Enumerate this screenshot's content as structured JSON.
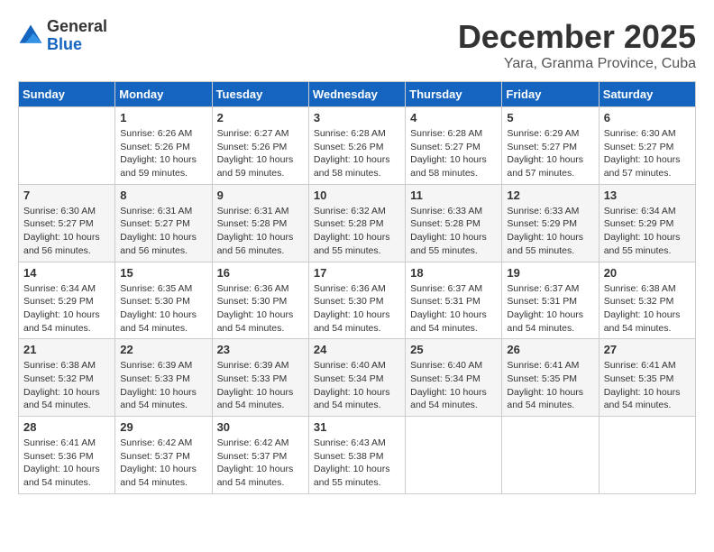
{
  "header": {
    "logo_line1": "General",
    "logo_line2": "Blue",
    "month": "December 2025",
    "location": "Yara, Granma Province, Cuba"
  },
  "days": [
    "Sunday",
    "Monday",
    "Tuesday",
    "Wednesday",
    "Thursday",
    "Friday",
    "Saturday"
  ],
  "weeks": [
    [
      {
        "date": "",
        "info": ""
      },
      {
        "date": "1",
        "info": "Sunrise: 6:26 AM\nSunset: 5:26 PM\nDaylight: 10 hours\nand 59 minutes."
      },
      {
        "date": "2",
        "info": "Sunrise: 6:27 AM\nSunset: 5:26 PM\nDaylight: 10 hours\nand 59 minutes."
      },
      {
        "date": "3",
        "info": "Sunrise: 6:28 AM\nSunset: 5:26 PM\nDaylight: 10 hours\nand 58 minutes."
      },
      {
        "date": "4",
        "info": "Sunrise: 6:28 AM\nSunset: 5:27 PM\nDaylight: 10 hours\nand 58 minutes."
      },
      {
        "date": "5",
        "info": "Sunrise: 6:29 AM\nSunset: 5:27 PM\nDaylight: 10 hours\nand 57 minutes."
      },
      {
        "date": "6",
        "info": "Sunrise: 6:30 AM\nSunset: 5:27 PM\nDaylight: 10 hours\nand 57 minutes."
      }
    ],
    [
      {
        "date": "7",
        "info": "Sunrise: 6:30 AM\nSunset: 5:27 PM\nDaylight: 10 hours\nand 56 minutes."
      },
      {
        "date": "8",
        "info": "Sunrise: 6:31 AM\nSunset: 5:27 PM\nDaylight: 10 hours\nand 56 minutes."
      },
      {
        "date": "9",
        "info": "Sunrise: 6:31 AM\nSunset: 5:28 PM\nDaylight: 10 hours\nand 56 minutes."
      },
      {
        "date": "10",
        "info": "Sunrise: 6:32 AM\nSunset: 5:28 PM\nDaylight: 10 hours\nand 55 minutes."
      },
      {
        "date": "11",
        "info": "Sunrise: 6:33 AM\nSunset: 5:28 PM\nDaylight: 10 hours\nand 55 minutes."
      },
      {
        "date": "12",
        "info": "Sunrise: 6:33 AM\nSunset: 5:29 PM\nDaylight: 10 hours\nand 55 minutes."
      },
      {
        "date": "13",
        "info": "Sunrise: 6:34 AM\nSunset: 5:29 PM\nDaylight: 10 hours\nand 55 minutes."
      }
    ],
    [
      {
        "date": "14",
        "info": "Sunrise: 6:34 AM\nSunset: 5:29 PM\nDaylight: 10 hours\nand 54 minutes."
      },
      {
        "date": "15",
        "info": "Sunrise: 6:35 AM\nSunset: 5:30 PM\nDaylight: 10 hours\nand 54 minutes."
      },
      {
        "date": "16",
        "info": "Sunrise: 6:36 AM\nSunset: 5:30 PM\nDaylight: 10 hours\nand 54 minutes."
      },
      {
        "date": "17",
        "info": "Sunrise: 6:36 AM\nSunset: 5:30 PM\nDaylight: 10 hours\nand 54 minutes."
      },
      {
        "date": "18",
        "info": "Sunrise: 6:37 AM\nSunset: 5:31 PM\nDaylight: 10 hours\nand 54 minutes."
      },
      {
        "date": "19",
        "info": "Sunrise: 6:37 AM\nSunset: 5:31 PM\nDaylight: 10 hours\nand 54 minutes."
      },
      {
        "date": "20",
        "info": "Sunrise: 6:38 AM\nSunset: 5:32 PM\nDaylight: 10 hours\nand 54 minutes."
      }
    ],
    [
      {
        "date": "21",
        "info": "Sunrise: 6:38 AM\nSunset: 5:32 PM\nDaylight: 10 hours\nand 54 minutes."
      },
      {
        "date": "22",
        "info": "Sunrise: 6:39 AM\nSunset: 5:33 PM\nDaylight: 10 hours\nand 54 minutes."
      },
      {
        "date": "23",
        "info": "Sunrise: 6:39 AM\nSunset: 5:33 PM\nDaylight: 10 hours\nand 54 minutes."
      },
      {
        "date": "24",
        "info": "Sunrise: 6:40 AM\nSunset: 5:34 PM\nDaylight: 10 hours\nand 54 minutes."
      },
      {
        "date": "25",
        "info": "Sunrise: 6:40 AM\nSunset: 5:34 PM\nDaylight: 10 hours\nand 54 minutes."
      },
      {
        "date": "26",
        "info": "Sunrise: 6:41 AM\nSunset: 5:35 PM\nDaylight: 10 hours\nand 54 minutes."
      },
      {
        "date": "27",
        "info": "Sunrise: 6:41 AM\nSunset: 5:35 PM\nDaylight: 10 hours\nand 54 minutes."
      }
    ],
    [
      {
        "date": "28",
        "info": "Sunrise: 6:41 AM\nSunset: 5:36 PM\nDaylight: 10 hours\nand 54 minutes."
      },
      {
        "date": "29",
        "info": "Sunrise: 6:42 AM\nSunset: 5:37 PM\nDaylight: 10 hours\nand 54 minutes."
      },
      {
        "date": "30",
        "info": "Sunrise: 6:42 AM\nSunset: 5:37 PM\nDaylight: 10 hours\nand 54 minutes."
      },
      {
        "date": "31",
        "info": "Sunrise: 6:43 AM\nSunset: 5:38 PM\nDaylight: 10 hours\nand 55 minutes."
      },
      {
        "date": "",
        "info": ""
      },
      {
        "date": "",
        "info": ""
      },
      {
        "date": "",
        "info": ""
      }
    ]
  ]
}
